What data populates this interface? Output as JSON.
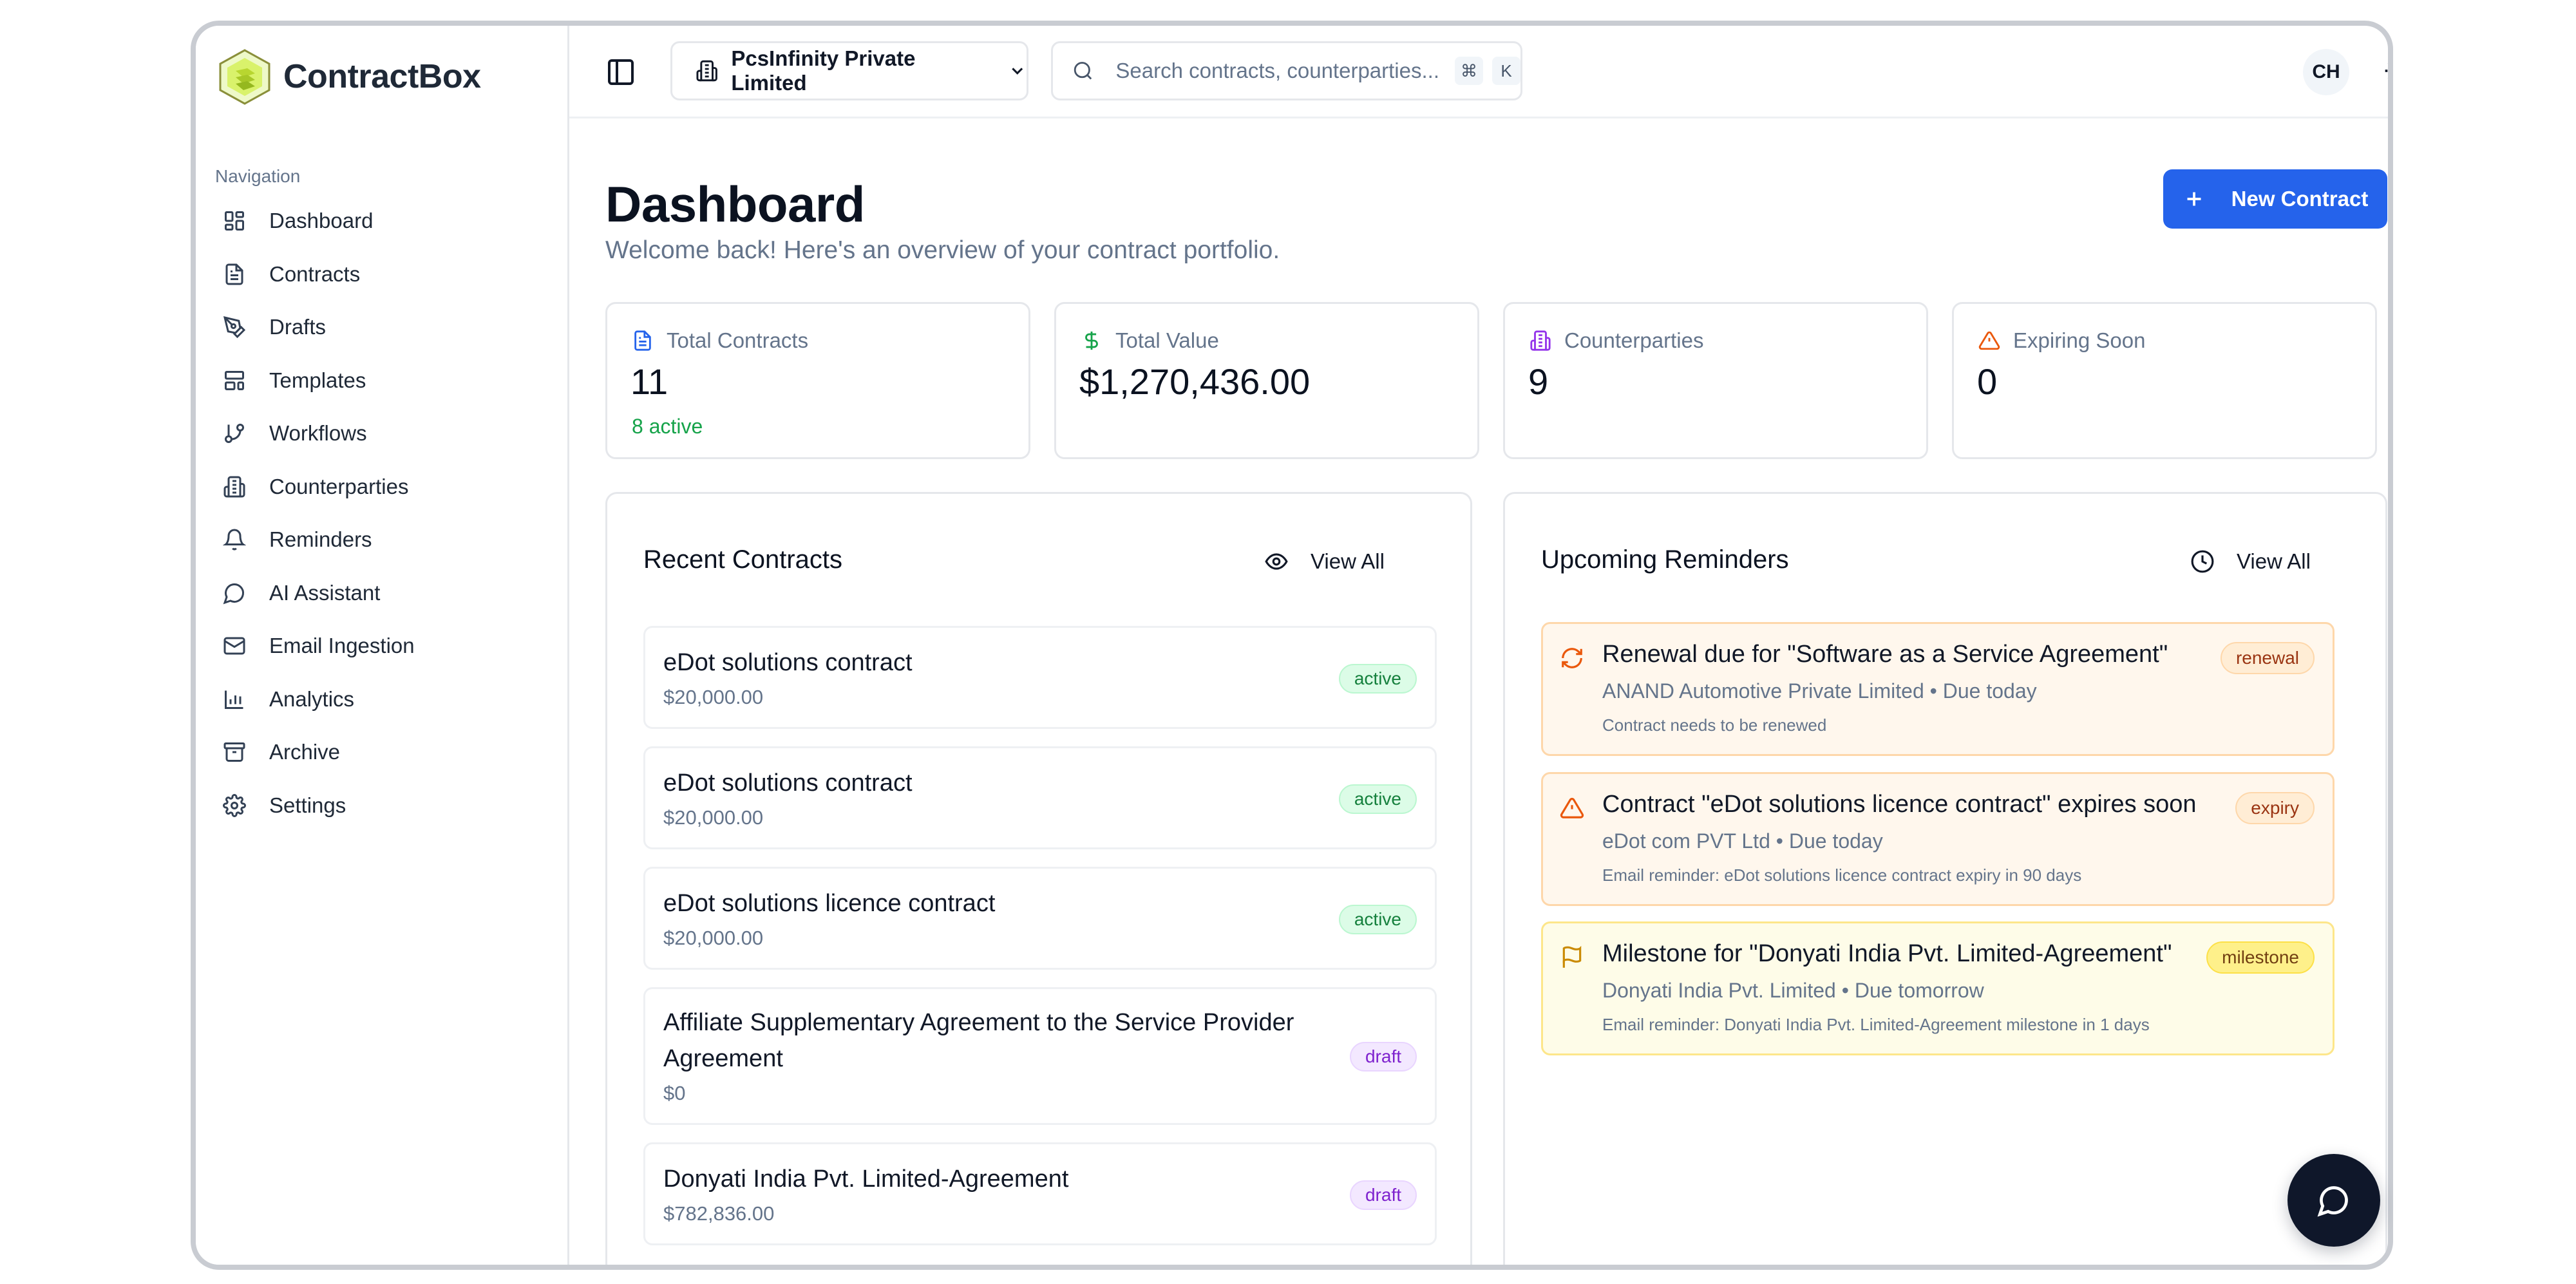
{
  "app": {
    "name": "ContractBox"
  },
  "sidebar": {
    "heading": "Navigation",
    "items": [
      {
        "label": "Dashboard",
        "icon": "layout-grid-icon"
      },
      {
        "label": "Contracts",
        "icon": "file-text-icon"
      },
      {
        "label": "Drafts",
        "icon": "pen-tool-icon"
      },
      {
        "label": "Templates",
        "icon": "layout-template-icon"
      },
      {
        "label": "Workflows",
        "icon": "git-branch-icon"
      },
      {
        "label": "Counterparties",
        "icon": "building-icon"
      },
      {
        "label": "Reminders",
        "icon": "bell-icon"
      },
      {
        "label": "AI Assistant",
        "icon": "message-circle-icon"
      },
      {
        "label": "Email Ingestion",
        "icon": "mail-icon"
      },
      {
        "label": "Analytics",
        "icon": "bar-chart-icon"
      },
      {
        "label": "Archive",
        "icon": "archive-icon"
      },
      {
        "label": "Settings",
        "icon": "gear-icon"
      }
    ]
  },
  "topbar": {
    "organization": "PcsInfinity Private Limited",
    "search_placeholder": "Search contracts, counterparties...",
    "shortcut_keys": [
      "⌘",
      "K"
    ],
    "avatar_initials": "CH"
  },
  "dashboard": {
    "title": "Dashboard",
    "subtitle": "Welcome back! Here's an overview of your contract portfolio.",
    "new_contract_label": "New Contract",
    "stats": [
      {
        "label": "Total Contracts",
        "value": "11",
        "sub": "8 active",
        "icon": "file-text-icon",
        "color": "#2563eb"
      },
      {
        "label": "Total Value",
        "value": "$1,270,436.00",
        "sub": "",
        "icon": "dollar-sign-icon",
        "color": "#16a34a"
      },
      {
        "label": "Counterparties",
        "value": "9",
        "sub": "",
        "icon": "building-icon",
        "color": "#9333ea"
      },
      {
        "label": "Expiring Soon",
        "value": "0",
        "sub": "",
        "icon": "alert-triangle-icon",
        "color": "#ea580c"
      }
    ]
  },
  "recent_contracts": {
    "title": "Recent Contracts",
    "view_all_label": "View All",
    "items": [
      {
        "name": "eDot solutions contract",
        "value": "$20,000.00",
        "status": "active"
      },
      {
        "name": "eDot solutions contract",
        "value": "$20,000.00",
        "status": "active"
      },
      {
        "name": "eDot solutions licence contract",
        "value": "$20,000.00",
        "status": "active"
      },
      {
        "name": "Affiliate Supplementary Agreement to the Service Provider Agreement",
        "value": "$0",
        "status": "draft"
      },
      {
        "name": "Donyati India Pvt. Limited-Agreement",
        "value": "$782,836.00",
        "status": "draft"
      }
    ]
  },
  "reminders": {
    "title": "Upcoming Reminders",
    "view_all_label": "View All",
    "items": [
      {
        "title": "Renewal due for \"Software as a Service Agreement\"",
        "meta": "ANAND Automotive Private Limited • Due today",
        "note": "Contract needs to be renewed",
        "type": "renewal",
        "icon": "refresh-icon"
      },
      {
        "title": "Contract \"eDot solutions licence contract\" expires soon",
        "meta": "eDot com PVT Ltd • Due today",
        "note": "Email reminder: eDot solutions licence contract expiry in 90 days",
        "type": "expiry",
        "icon": "alert-triangle-icon"
      },
      {
        "title": "Milestone for \"Donyati India Pvt. Limited-Agreement\"",
        "meta": "Donyati India Pvt. Limited • Due tomorrow",
        "note": "Email reminder: Donyati India Pvt. Limited-Agreement milestone in 1 days",
        "type": "milestone",
        "icon": "flag-icon"
      }
    ]
  },
  "colors": {
    "primary": "#2563eb",
    "active_badge": "#15803d",
    "draft_badge": "#7e22ce",
    "reminder_orange": "#ea580c",
    "reminder_yellow": "#ca8a04"
  }
}
